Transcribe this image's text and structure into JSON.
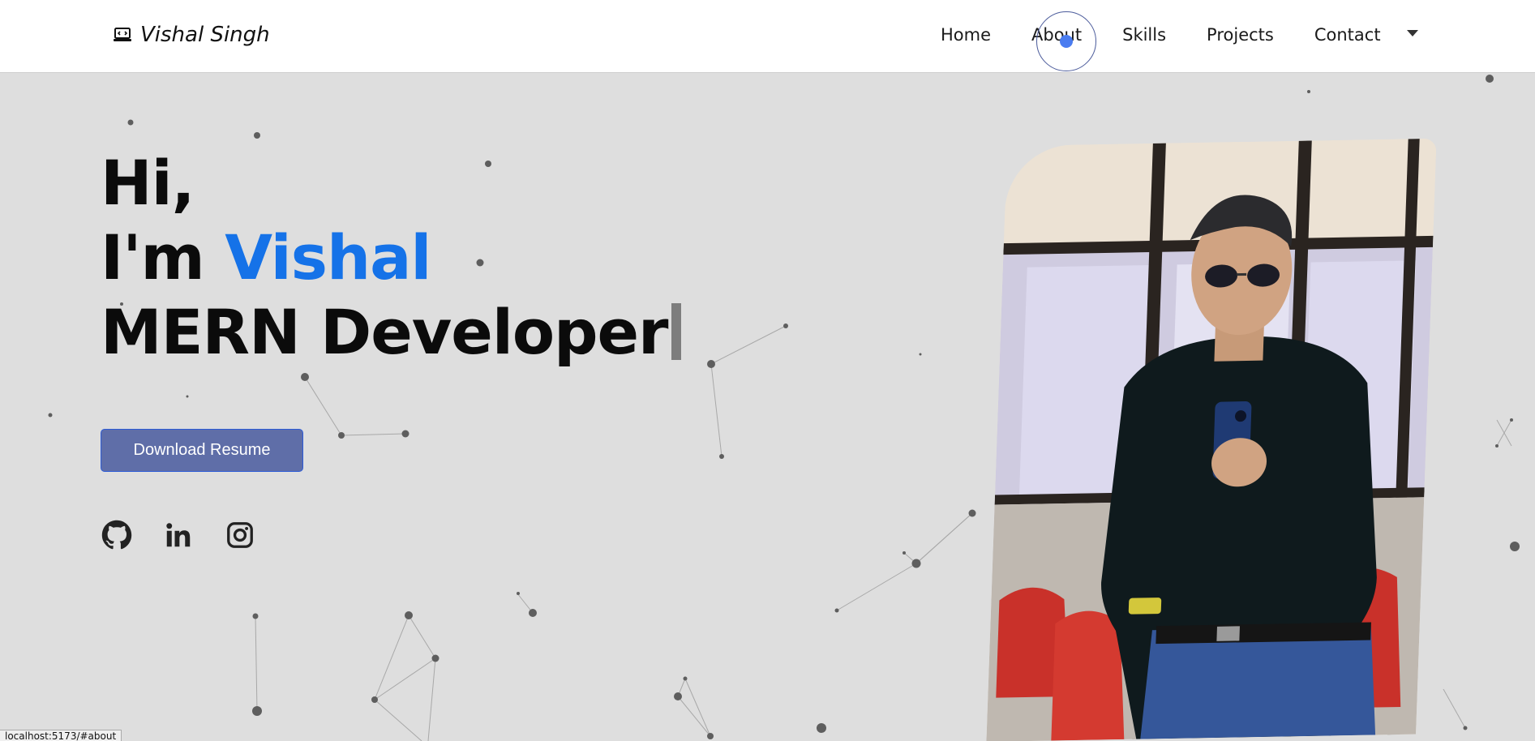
{
  "nav": {
    "brand": "Vishal Singh",
    "brand_icon": "laptop-code-icon",
    "links": [
      "Home",
      "About",
      "Skills",
      "Projects",
      "Contact"
    ],
    "dropdown_icon": "caret-down-icon"
  },
  "hero": {
    "line1": "Hi,",
    "line2_prefix": "I'm ",
    "line2_name": "Vishal",
    "line3": "MERN Developer",
    "resume_button": "Download Resume",
    "socials": [
      "github-icon",
      "linkedin-icon",
      "instagram-icon"
    ]
  },
  "colors": {
    "accent": "#1572e8",
    "button_bg": "#5f6ea8",
    "background": "#dedede",
    "cursor_dot": "#4a7cf0"
  },
  "status_bar": "localhost:5173/#about"
}
